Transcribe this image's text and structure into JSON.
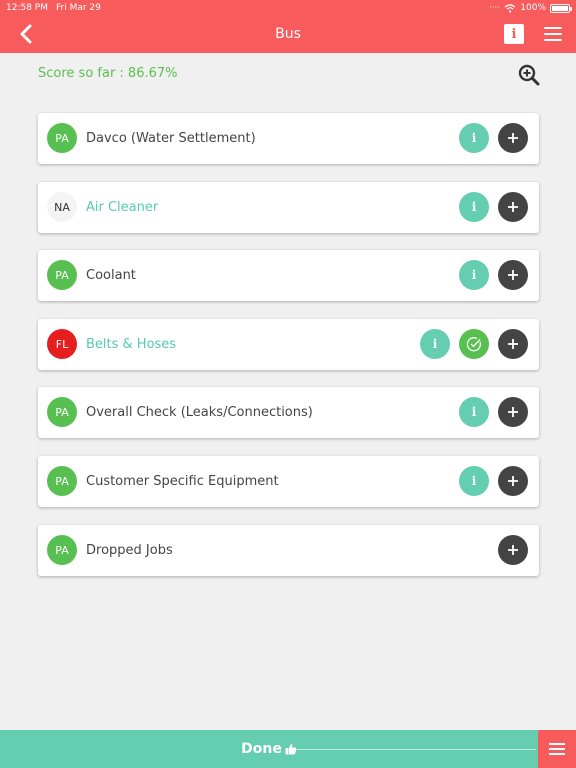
{
  "status_bar": {
    "time": "12:58 PM",
    "date": "Fri Mar 29",
    "battery": "100%"
  },
  "nav": {
    "title": "Bus",
    "info_glyph": "i"
  },
  "score": {
    "text": "Score so far : 86.67%"
  },
  "items": [
    {
      "badge": "PA",
      "status": "pass",
      "label": "Davco (Water Settlement)",
      "label_color": "default",
      "has_info": true,
      "has_check": false
    },
    {
      "badge": "NA",
      "status": "na",
      "label": "Air Cleaner",
      "label_color": "teal",
      "has_info": true,
      "has_check": false
    },
    {
      "badge": "PA",
      "status": "pass",
      "label": "Coolant",
      "label_color": "default",
      "has_info": true,
      "has_check": false
    },
    {
      "badge": "FL",
      "status": "fail",
      "label": "Belts & Hoses",
      "label_color": "teal",
      "has_info": true,
      "has_check": true
    },
    {
      "badge": "PA",
      "status": "pass",
      "label": "Overall Check (Leaks/Connections)",
      "label_color": "default",
      "has_info": true,
      "has_check": false
    },
    {
      "badge": "PA",
      "status": "pass",
      "label": "Customer Specific Equipment",
      "label_color": "default",
      "has_info": true,
      "has_check": false
    },
    {
      "badge": "PA",
      "status": "pass",
      "label": "Dropped Jobs",
      "label_color": "default",
      "has_info": false,
      "has_check": false
    }
  ],
  "footer": {
    "done_label": "Done"
  },
  "colors": {
    "header": "#f75b5b",
    "pass": "#58c050",
    "fail": "#e51f1f",
    "teal": "#65cdb0",
    "dark": "#444444"
  },
  "icons": {
    "back": "chevron-left-icon",
    "info": "info-icon",
    "menu": "hamburger-menu-icon",
    "zoom": "zoom-in-icon",
    "add": "plus-icon",
    "check": "check-circle-icon",
    "thumb": "thumbs-up-icon"
  }
}
